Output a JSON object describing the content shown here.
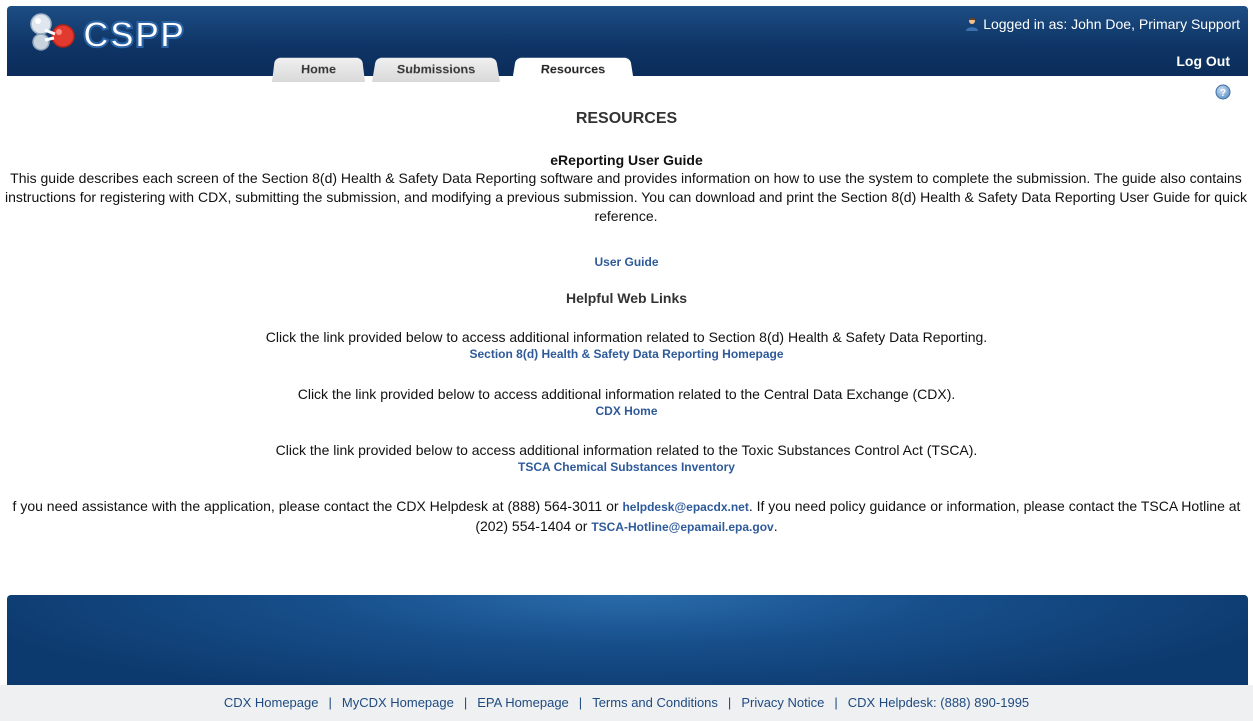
{
  "header": {
    "logo_text": "CSPP",
    "logged_in": "Logged in as: John Doe, Primary Support",
    "logout": "Log Out"
  },
  "tabs": [
    {
      "label": "Home"
    },
    {
      "label": "Submissions"
    },
    {
      "label": "Resources"
    }
  ],
  "main": {
    "title": "RESOURCES",
    "guide_title": "eReporting User Guide",
    "guide_desc": "This guide describes each screen of the Section 8(d) Health & Safety Data Reporting software and provides information on how to use the system to complete the submission. The guide also contains instructions for registering with CDX, submitting the submission, and modifying a previous submission. You can download and print the Section 8(d) Health & Safety Data Reporting User Guide for quick reference.",
    "user_guide_link": "User Guide",
    "links_title": "Helpful Web Links",
    "link_blocks": [
      {
        "text": "Click the link provided below to access additional information related to Section 8(d) Health & Safety Data Reporting.",
        "link": "Section 8(d) Health & Safety Data Reporting Homepage"
      },
      {
        "text": "Click the link provided below to access additional information related to the Central Data Exchange (CDX).",
        "link": "CDX Home"
      },
      {
        "text": "Click the link provided below to access additional information related to the Toxic Substances Control Act (TSCA).",
        "link": "TSCA Chemical Substances Inventory"
      }
    ],
    "contact": {
      "part1": "f you need assistance with the application, please contact the CDX Helpdesk at (888) 564-3011 or ",
      "email1": "helpdesk@epacdx.net",
      "part2": ". If you need policy guidance or information, please contact the TSCA Hotline at (202) 554-1404 or ",
      "email2": "TSCA-Hotline@epamail.epa.gov",
      "part3": "."
    }
  },
  "footer": {
    "links": [
      "CDX Homepage",
      "MyCDX Homepage",
      "EPA Homepage",
      "Terms and Conditions",
      "Privacy Notice",
      "CDX Helpdesk: (888) 890-1995"
    ],
    "separator": "|"
  },
  "colors": {
    "header_blue": "#0f3566",
    "link_blue": "#2e5a9a",
    "footer_bg": "#eef0f2"
  }
}
